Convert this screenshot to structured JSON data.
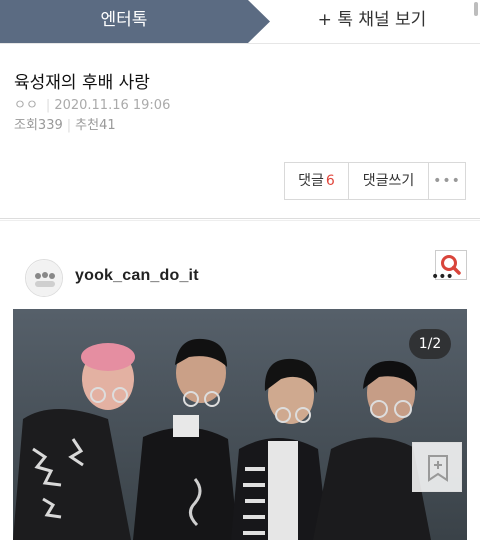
{
  "tabs": {
    "active_label": "엔터톡",
    "channel_label": "+ 톡 채널 보기"
  },
  "post": {
    "title": "육성재의 후배 사랑",
    "author": "ㅇㅇ",
    "date": "2020.11.16 19:06",
    "views_label": "조회",
    "views": "339",
    "recommend_label": "추천",
    "recommends": "41"
  },
  "actions": {
    "comment_label": "댓글",
    "comment_count": "6",
    "write_label": "댓글쓰기",
    "more_label": "•••"
  },
  "embed": {
    "username": "yook_can_do_it",
    "page_indicator": "1/2",
    "menu_dots": "•••"
  },
  "colors": {
    "tab_active_bg": "#5b6b82",
    "comment_count": "#e0463c",
    "zoom_icon": "#d9453b"
  }
}
